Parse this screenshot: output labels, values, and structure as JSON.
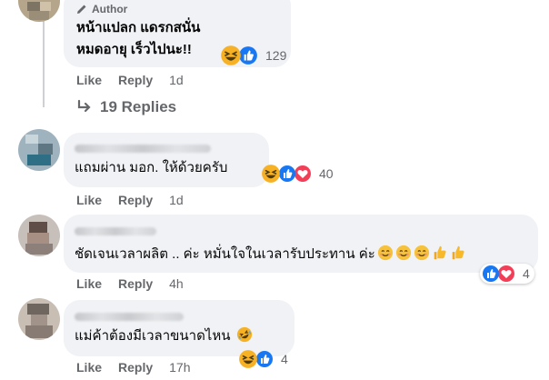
{
  "comments": [
    {
      "author_badge": "Author",
      "text_line1": "หน้าแปลก แดรกสนั่น",
      "text_line2": "หมดอายุ เร็วไปนะ!!",
      "reaction_count": "129",
      "like": "Like",
      "reply": "Reply",
      "time": "1d",
      "view_replies": "19 Replies"
    },
    {
      "text": "แถมผ่าน มอก. ให้ด้วยครับ",
      "reaction_count": "40",
      "like": "Like",
      "reply": "Reply",
      "time": "1d"
    },
    {
      "text": "ชัดเจนเวลาผลิต .. ค่ะ หมั่นใจในเวลารับประทาน ค่ะ",
      "reaction_count": "4",
      "like": "Like",
      "reply": "Reply",
      "time": "4h"
    },
    {
      "text": "แม่ค้าต้องมีเวลาขนาดไหน",
      "reaction_count": "4",
      "like": "Like",
      "reply": "Reply",
      "time": "17h"
    }
  ],
  "icons": {
    "author": "pencil-icon",
    "replies": "reply-arrow-icon",
    "reactions": [
      "haha-reaction-icon",
      "like-reaction-icon",
      "love-reaction-icon"
    ]
  },
  "colors": {
    "bubble": "#f0f2f5",
    "secondary_text": "#65676b",
    "like_blue": "#1877f2",
    "love_red": "#f33e58",
    "haha_yellow": "#f7b125"
  }
}
